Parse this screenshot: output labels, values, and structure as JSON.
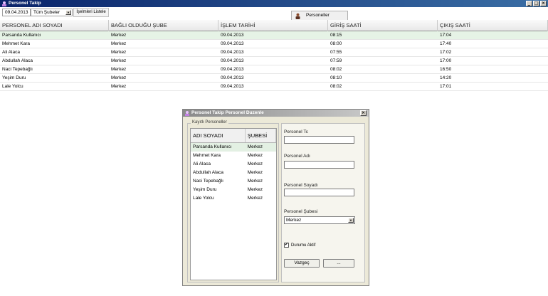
{
  "window": {
    "title": "Personel Takip",
    "buttons": {
      "minimize": "_",
      "maximize": "□",
      "close": "×"
    }
  },
  "toolbar": {
    "date_value": "09.04.2013",
    "branch_selected": "Tüm Şubeler",
    "list_button": "İşelmleri Listele",
    "personnel_button": "Personeller"
  },
  "grid": {
    "columns": [
      "PERSONEL ADI SOYADI",
      "BAĞLI OLDUĞU ŞUBE",
      "İŞLEM TARİHİ",
      "GİRİŞ SAATİ",
      "ÇIKIŞ SAATİ"
    ],
    "rows": [
      [
        "Parsanda Kullanıcı",
        "Merkez",
        "09.04.2013",
        "08:15",
        "17:04"
      ],
      [
        "Mehmet Kara",
        "Merkez",
        "09.04.2013",
        "08:00",
        "17:40"
      ],
      [
        "Ali Alaca",
        "Merkez",
        "09.04.2013",
        "07:55",
        "17:02"
      ],
      [
        "Abdullah Alaca",
        "Merkez",
        "09.04.2013",
        "07:59",
        "17:00"
      ],
      [
        "Naci Tepebağlı",
        "Merkez",
        "09.04.2013",
        "08:02",
        "16:50"
      ],
      [
        "Yeşim Duru",
        "Merkez",
        "09.04.2013",
        "08:10",
        "14:20"
      ],
      [
        "Lale Yolcu",
        "Merkez",
        "09.04.2013",
        "08:02",
        "17:01"
      ]
    ]
  },
  "dialog": {
    "title": "Personel Takip Personel Duzenle",
    "close": "×",
    "group_label": "Kayıtlı Personeller",
    "list_columns": [
      "ADI SOYADI",
      "ŞUBESİ"
    ],
    "list_rows": [
      [
        "Parsanda Kullanıcı",
        "Merkez"
      ],
      [
        "Mehmet Kara",
        "Merkez"
      ],
      [
        "Ali Alaca",
        "Merkez"
      ],
      [
        "Abdullah Alaca",
        "Merkez"
      ],
      [
        "Naci Tepebağlı",
        "Merkez"
      ],
      [
        "Yeşim Duru",
        "Merkez"
      ],
      [
        "Lale Yolcu",
        "Merkez"
      ]
    ],
    "fields": {
      "tc_label": "Personel Tc",
      "tc_value": "",
      "name_label": "Personel Adı",
      "name_value": "",
      "surname_label": "Personel Soyadı",
      "surname_value": "",
      "branch_label": "Personel Şubesi",
      "branch_value": "Merkez"
    },
    "active_label": "Durumu Aktif",
    "active_checked": "✔",
    "cancel_button": "Vazgeç",
    "other_button": "..."
  },
  "colors": {
    "titlebar": "#0a246a",
    "selected_row": "#e6f3e6",
    "dialog_bg": "#ece9d8"
  },
  "icons": [
    "window-app-icon",
    "user-icon",
    "dialog-app-icon",
    "dropdown-arrow-icon",
    "checkmark-icon"
  ]
}
